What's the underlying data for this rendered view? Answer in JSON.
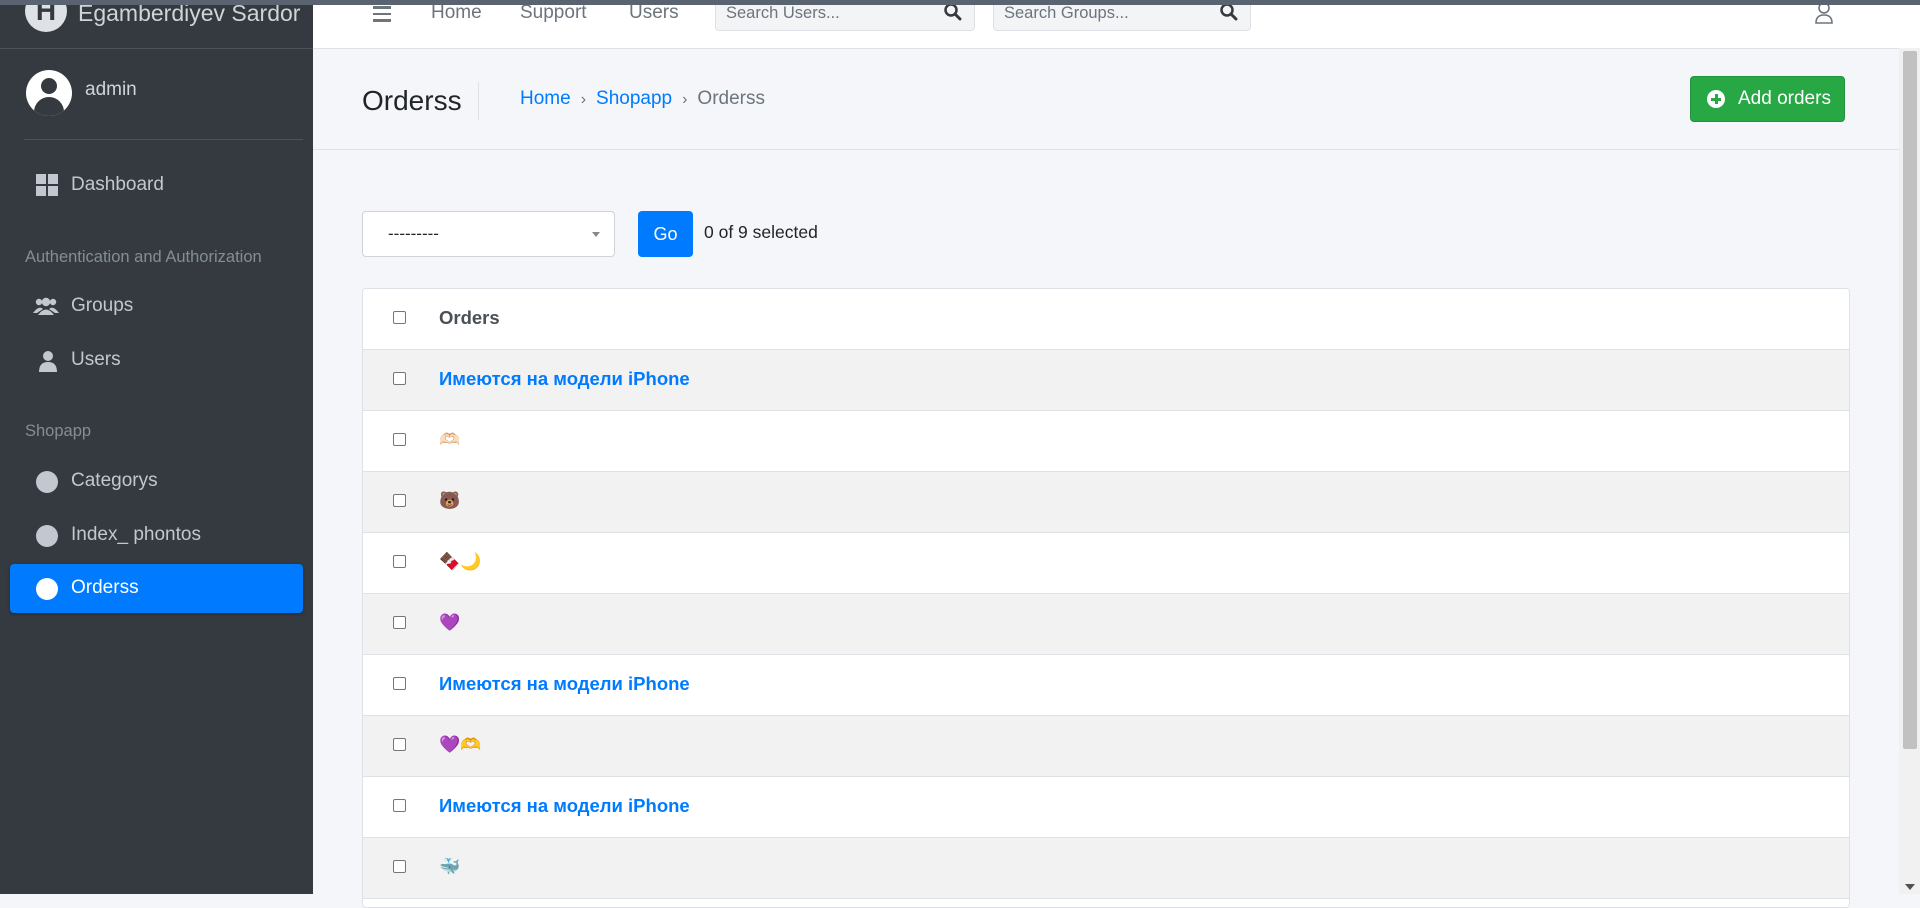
{
  "brand": {
    "logo_letter": "H",
    "name": "Egamberdiyev Sardor"
  },
  "user": {
    "name": "admin"
  },
  "sidebar": {
    "dashboard": "Dashboard",
    "section_auth": "Authentication and Authorization",
    "groups": "Groups",
    "users": "Users",
    "section_shop": "Shopapp",
    "categorys": "Categorys",
    "index_photos": "Index_ phontos",
    "orders": "Orderss"
  },
  "topbar": {
    "home": "Home",
    "support": "Support",
    "users": "Users",
    "search_users_placeholder": "Search Users...",
    "search_groups_placeholder": "Search Groups..."
  },
  "header": {
    "title": "Orderss",
    "breadcrumb": [
      "Home",
      "Shopapp",
      "Orderss"
    ],
    "add_button": "Add orders"
  },
  "actions": {
    "select_value": "---------",
    "go_label": "Go",
    "selected_text": "0 of 9 selected"
  },
  "table": {
    "column_header": "Orders",
    "rows": [
      "Имеются на модели iPhone",
      "🫶🏻",
      "🐻",
      "🍫🌙",
      "💜",
      "Имеются на модели iPhone",
      "💜🫶",
      "Имеются на модели iPhone",
      "🐳"
    ]
  },
  "colors": {
    "sidebar_bg": "#343a40",
    "primary": "#007bff",
    "success": "#28a745"
  }
}
